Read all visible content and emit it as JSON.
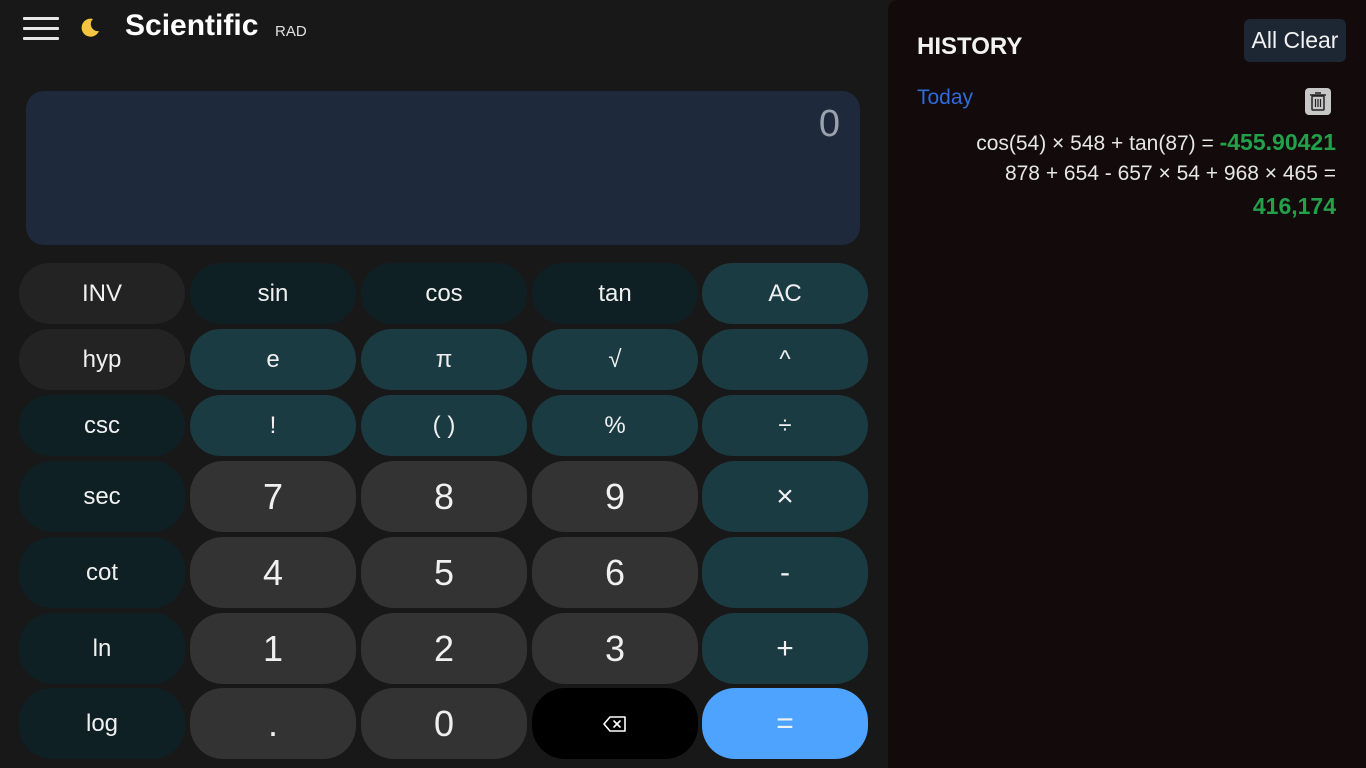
{
  "header": {
    "title": "Scientific",
    "mode": "RAD"
  },
  "display": {
    "value": "0"
  },
  "keypad": {
    "rows": [
      [
        "INV",
        "sin",
        "cos",
        "tan",
        "AC"
      ],
      [
        "hyp",
        "e",
        "π",
        "√",
        "^"
      ],
      [
        "csc",
        "!",
        "( )",
        "%",
        "÷"
      ],
      [
        "sec",
        "7",
        "8",
        "9",
        "×"
      ],
      [
        "cot",
        "4",
        "5",
        "6",
        "-"
      ],
      [
        "ln",
        "1",
        "2",
        "3",
        "+"
      ],
      [
        "log",
        ".",
        "0",
        "⌫",
        "="
      ]
    ]
  },
  "history": {
    "title": "HISTORY",
    "clear_label": "All Clear",
    "group_label": "Today",
    "entries": [
      {
        "expression": "cos(54) × 548 + tan(87) =",
        "result": "-455.90421"
      },
      {
        "expression": "878 + 654 - 657 × 54 + 968 × 465 =",
        "result": "416,174"
      }
    ]
  },
  "colors": {
    "display_bg": "#1e293b",
    "equals_bg": "#4da3ff",
    "result_green": "#22a14a",
    "today_blue": "#2f6bd9"
  }
}
